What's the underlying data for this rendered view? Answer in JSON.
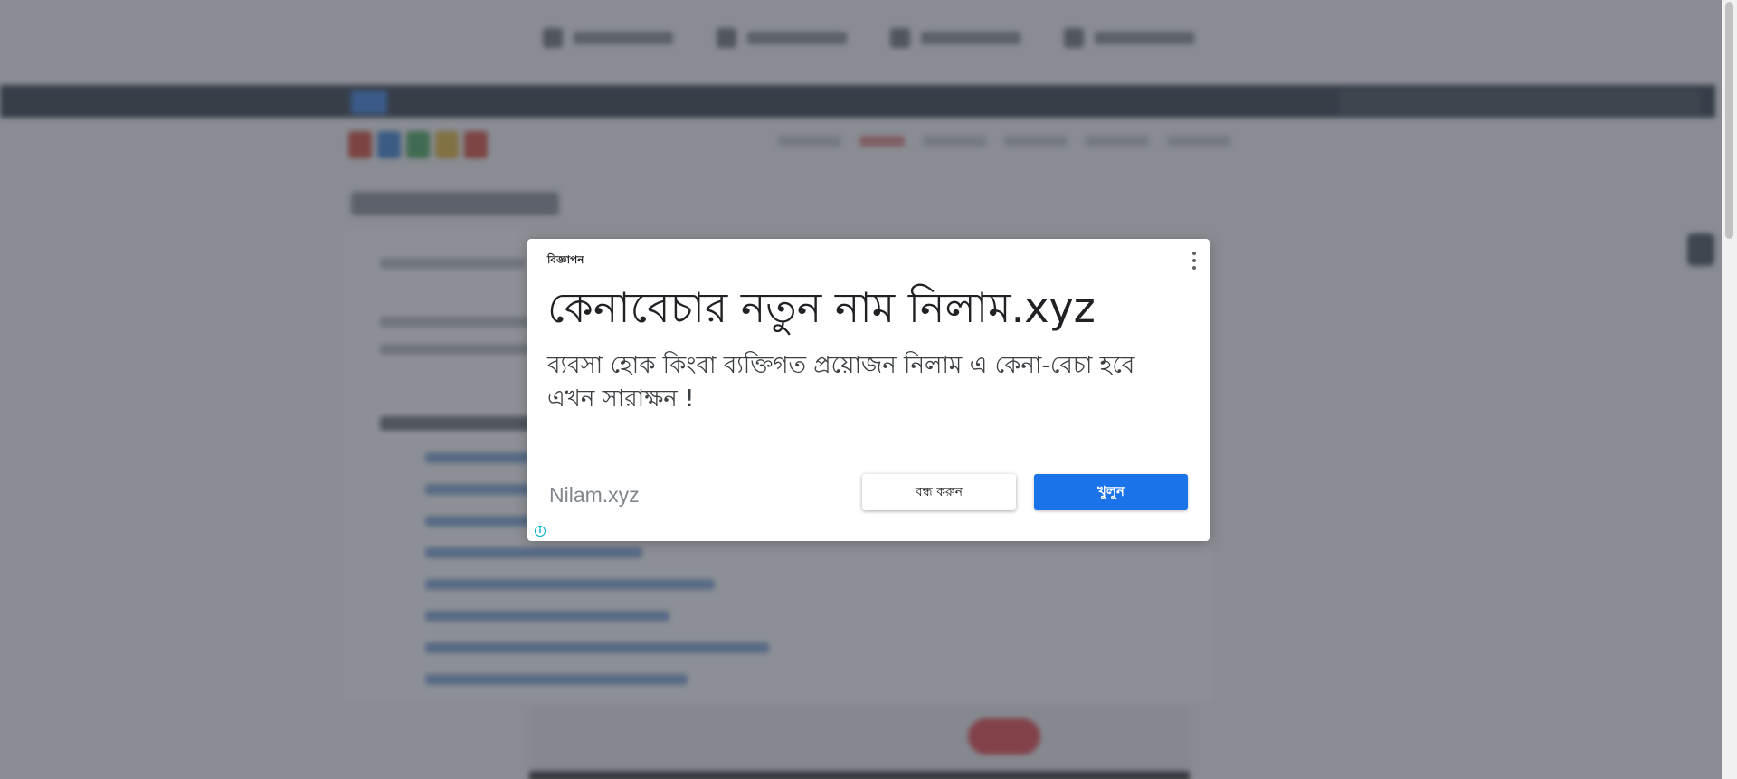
{
  "ad": {
    "label": "বিজ্ঞাপন",
    "headline": "কেনাবেচার নতুন নাম নিলাম.xyz",
    "body": "ব্যবসা হোক কিংবা ব্যক্তিগত প্রয়োজন নিলাম এ কেনা-বেচা হবে এখন সারাক্ষন !",
    "domain": "Nilam.xyz",
    "close_label": "বন্ধ করুন",
    "open_label": "খুলুন",
    "info_glyph": "i",
    "menu_icon": "more-vert-icon",
    "colors": {
      "open_button": "#1a73e8",
      "info_icon": "#00aecd"
    }
  }
}
